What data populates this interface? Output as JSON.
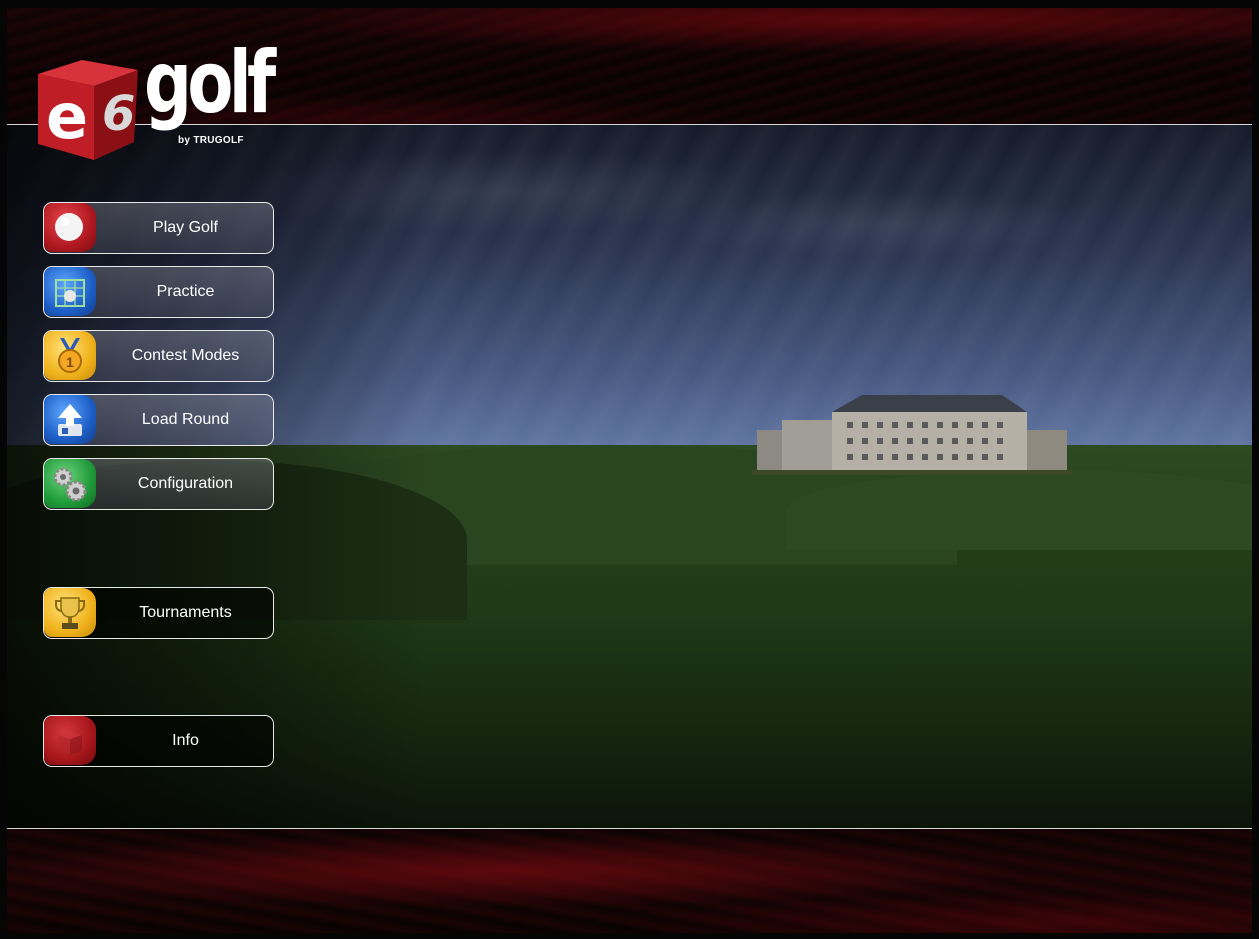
{
  "logo": {
    "wordmark": "golf",
    "byline": "by TRUGOLF",
    "cube_letters": [
      "e",
      "6"
    ]
  },
  "menu": [
    {
      "label": "Play Golf",
      "icon": "golf-ball-icon",
      "icon_color": "#b01820"
    },
    {
      "label": "Practice",
      "icon": "driving-range-net-icon",
      "icon_color": "#1d5fc7"
    },
    {
      "label": "Contest Modes",
      "icon": "gold-medal-icon",
      "icon_color": "#f0b21c"
    },
    {
      "label": "Load Round",
      "icon": "upload-arrow-icon",
      "icon_color": "#1d5fc7"
    },
    {
      "label": "Configuration",
      "icon": "gears-icon",
      "icon_color": "#1f9b3a"
    },
    {
      "label": "Tournaments",
      "icon": "trophy-icon",
      "icon_color": "#f0b21c"
    },
    {
      "label": "Info",
      "icon": "e6-logo-icon",
      "icon_color": "#a5161b"
    }
  ],
  "colors": {
    "accent_red": "#8a0c12",
    "divider": "#d8d8d8",
    "sky": "#6e86b6",
    "grass": "#24401a"
  }
}
